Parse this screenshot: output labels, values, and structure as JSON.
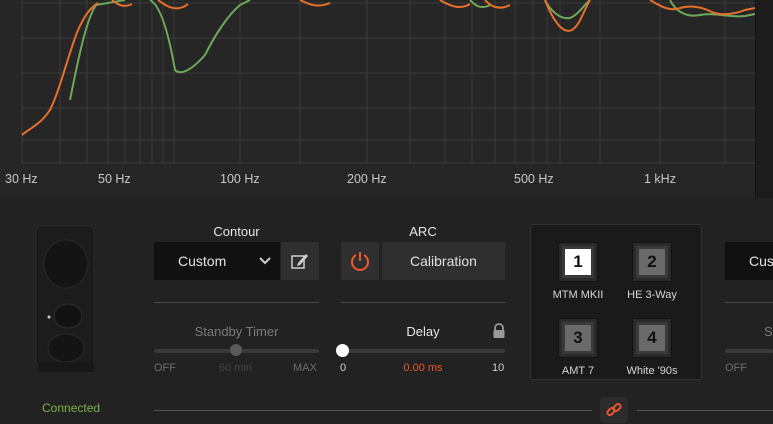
{
  "graph": {
    "freq_labels": [
      "30 Hz",
      "50 Hz",
      "100 Hz",
      "200 Hz",
      "500 Hz",
      "1 kHz"
    ],
    "curve_colors": {
      "orange": "#e8702a",
      "green": "#6ea85a"
    }
  },
  "contour": {
    "title": "Contour",
    "selected": "Custom"
  },
  "arc": {
    "title": "ARC",
    "calibration_label": "Calibration",
    "power_color": "#e8582a"
  },
  "standby": {
    "title": "Standby Timer",
    "off_label": "OFF",
    "max_label": "MAX",
    "value": "60 min"
  },
  "delay": {
    "title": "Delay",
    "min_label": "0",
    "max_label": "10",
    "value": "0.00 ms",
    "value_color": "#e8582a"
  },
  "presets": [
    {
      "number": "1",
      "label": "MTM MKII",
      "active": true
    },
    {
      "number": "2",
      "label": "HE 3-Way",
      "active": false
    },
    {
      "number": "3",
      "label": "AMT 7",
      "active": false
    },
    {
      "number": "4",
      "label": "White '90s",
      "active": false
    }
  ],
  "right_partial": {
    "select_fragment": "Cus",
    "title_fragment": "S",
    "off_label": "OFF"
  },
  "status": {
    "connection": "Connected",
    "connection_color": "#7cb342"
  }
}
